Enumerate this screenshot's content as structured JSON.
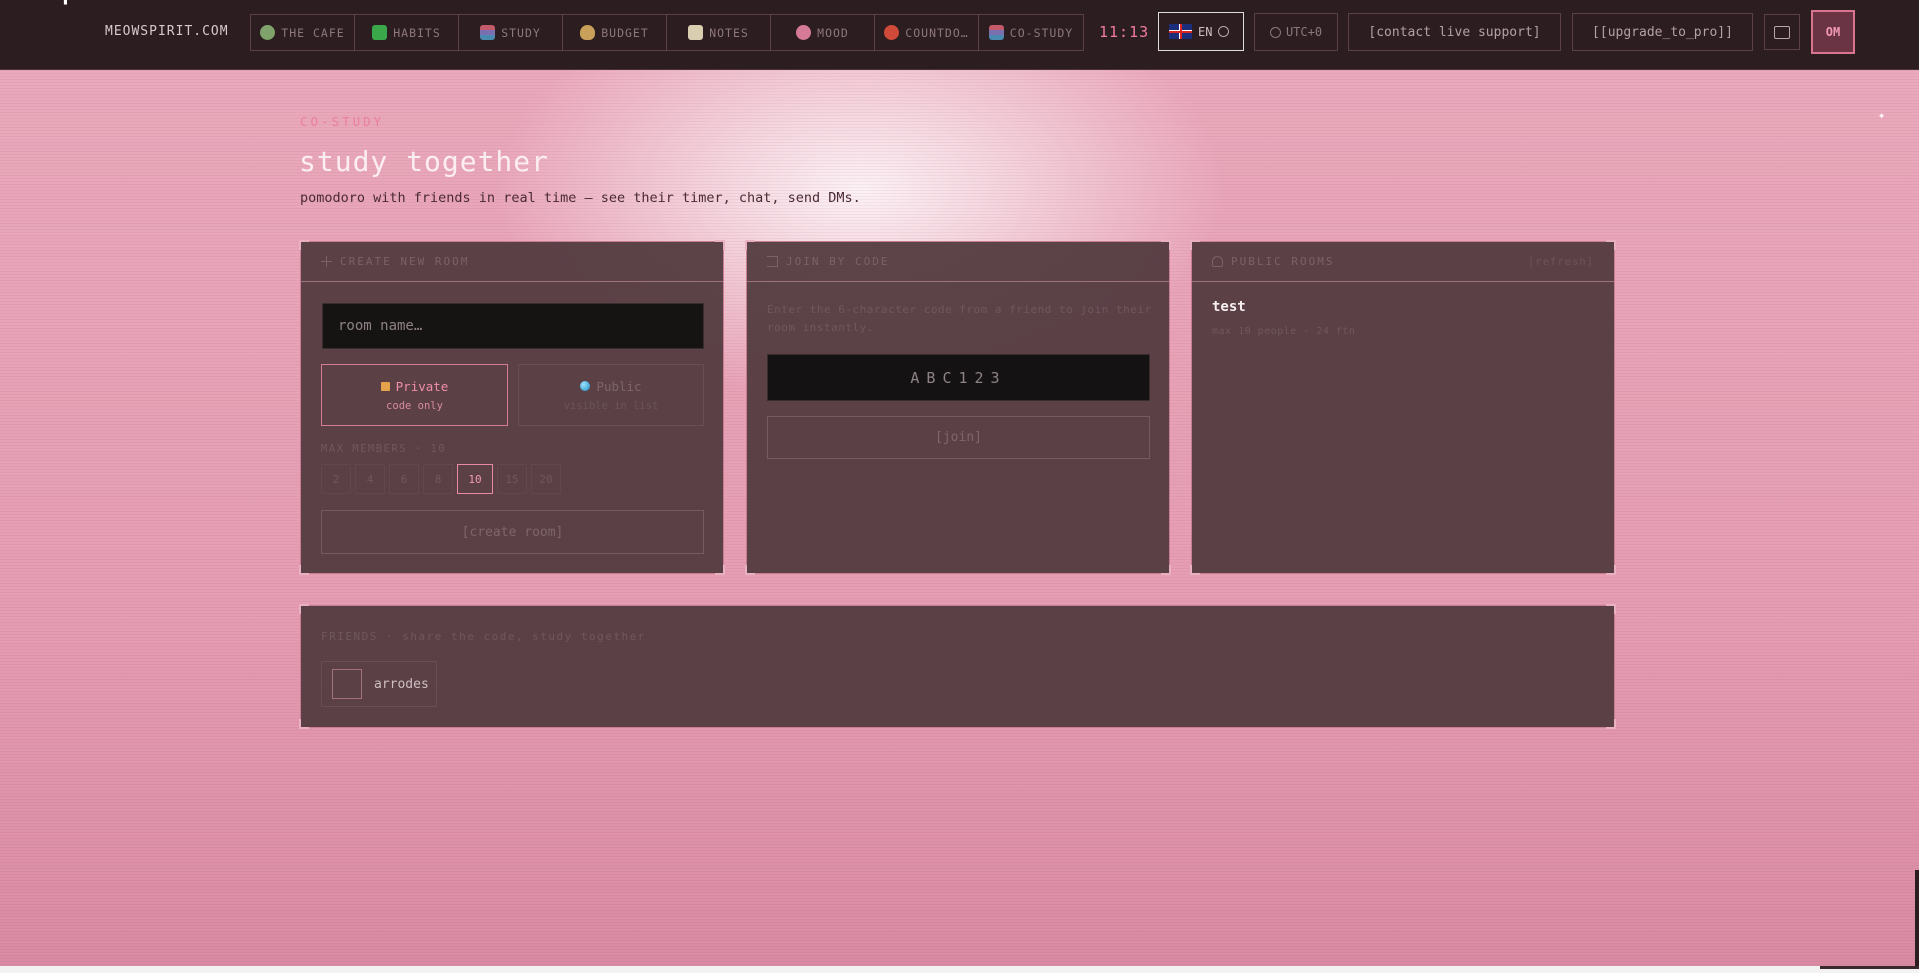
{
  "brand": "MEOWSPIRIT.COM",
  "nav": [
    {
      "label": "THE CAFE",
      "icon": "cafe-bowl-icon",
      "color": "#7fa36a"
    },
    {
      "label": "HABITS",
      "icon": "checkmark-icon",
      "color": "#3aa84a"
    },
    {
      "label": "STUDY",
      "icon": "books-icon",
      "color": "#7a6fb0"
    },
    {
      "label": "BUDGET",
      "icon": "money-bag-icon",
      "color": "#c9a05a"
    },
    {
      "label": "NOTES",
      "icon": "memo-icon",
      "color": "#b7a27a"
    },
    {
      "label": "MOOD",
      "icon": "flower-icon",
      "color": "#d67b97"
    },
    {
      "label": "COUNTDO…",
      "icon": "alarm-clock-icon",
      "color": "#d04a3a"
    },
    {
      "label": "CO-STUDY",
      "icon": "books-icon",
      "color": "#7a6fb0"
    }
  ],
  "clock": "11:13",
  "language": {
    "code": "EN",
    "flag": "uk-flag-icon"
  },
  "timezone": "UTC+0",
  "support_label": "[contact live support]",
  "upgrade_label": "[[upgrade_to_pro]]",
  "avatar_initials": "OM",
  "page": {
    "kicker": "CO-STUDY",
    "title": "study together",
    "subtitle": "pomodoro with friends in real time — see their timer, chat, send DMs."
  },
  "create": {
    "heading": "CREATE NEW ROOM",
    "placeholder": "room name…",
    "private_label": "Private",
    "private_sub": "code only",
    "public_label": "Public",
    "public_sub": "visible in list",
    "max_label": "MAX MEMBERS · 10",
    "sizes": [
      "2",
      "4",
      "6",
      "8",
      "10",
      "15",
      "20"
    ],
    "selected_size": "10",
    "button": "[create room]"
  },
  "join": {
    "heading": "JOIN BY CODE",
    "description": "Enter the 6-character code from a friend to join their room instantly.",
    "placeholder": "ABC123",
    "button": "[join]"
  },
  "public_rooms": {
    "heading": "PUBLIC ROOMS",
    "refresh": "[refresh]",
    "rooms": [
      {
        "name": "test",
        "meta": "max 10 people · 24 ftn"
      }
    ]
  },
  "friends": {
    "heading": "FRIENDS · share the code, study together",
    "list": [
      {
        "name": "arrodes"
      }
    ]
  },
  "colors": {
    "accent": "#f07aa0",
    "topbar": "#2b1d20",
    "panel": "#523a3f"
  }
}
